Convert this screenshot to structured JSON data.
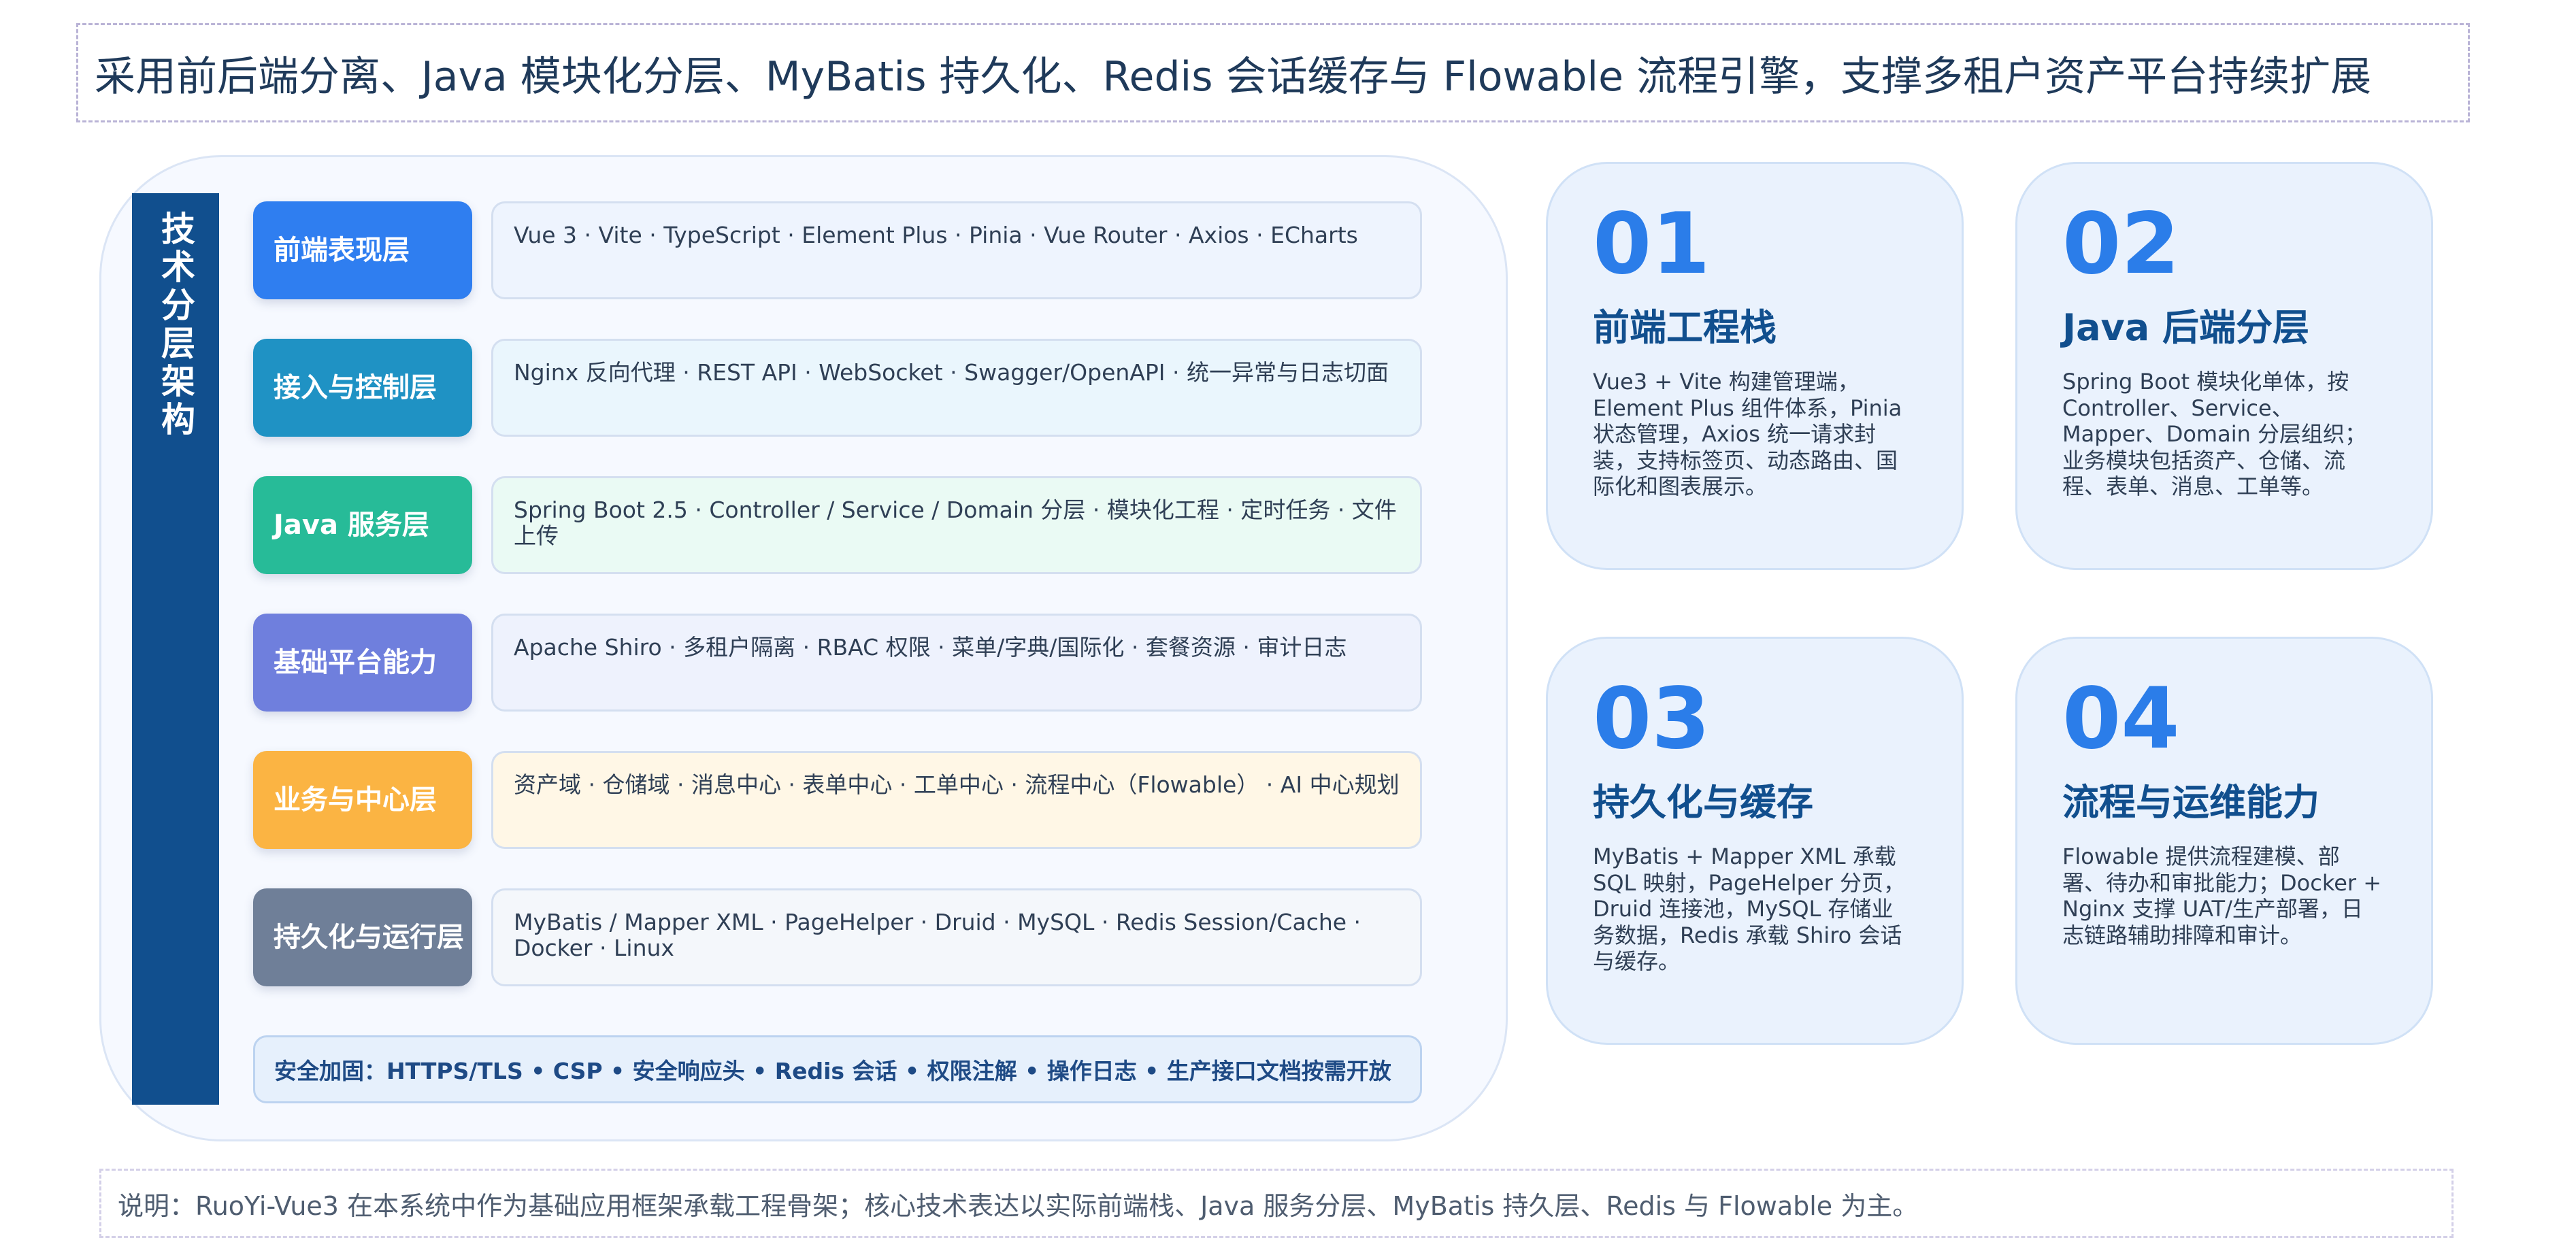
{
  "header": {
    "title": "采用前后端分离、Java 模块化分层、MyBatis 持久化、Redis 会话缓存与 Flowable 流程引擎，支撑多租户资产平台持续扩展"
  },
  "architecture": {
    "side_label": "技术分层架构",
    "layers": [
      {
        "label": "前端表现层",
        "color": "#2f7ef0",
        "desc_bg": "#eef4fe",
        "description": "Vue 3 · Vite · TypeScript · Element Plus · Pinia · Vue Router · Axios · ECharts"
      },
      {
        "label": "接入与控制层",
        "color": "#1f92c4",
        "desc_bg": "#eaf6fd",
        "description": "Nginx 反向代理 · REST API · WebSocket · Swagger/OpenAPI · 统一异常与日志切面"
      },
      {
        "label": "Java 服务层",
        "color": "#27bb98",
        "desc_bg": "#eafaf4",
        "description": "Spring Boot 2.5 · Controller / Service / Domain 分层 · 模块化工程 · 定时任务 · 文件上传"
      },
      {
        "label": "基础平台能力",
        "color": "#6f7fdd",
        "desc_bg": "#eef2fd",
        "description": "Apache Shiro · 多租户隔离 · RBAC 权限 · 菜单/字典/国际化 · 套餐资源 · 审计日志"
      },
      {
        "label": "业务与中心层",
        "color": "#fbb443",
        "desc_bg": "#fff7e6",
        "description": "资产域 · 仓储域 · 消息中心 · 表单中心 · 工单中心 · 流程中心（Flowable） · AI 中心规划"
      },
      {
        "label": "持久化与运行层",
        "color": "#6f7f98",
        "desc_bg": "#f4f7fb",
        "description": "MyBatis / Mapper XML · PageHelper · Druid · MySQL · Redis Session/Cache · Docker · Linux"
      }
    ],
    "security": "安全加固：HTTPS/TLS • CSP • 安全响应头 • Redis 会话 • 权限注解 • 操作日志 • 生产接口文档按需开放"
  },
  "cards": [
    {
      "num": "01",
      "title": "前端工程栈",
      "text": "Vue3 + Vite 构建管理端，Element Plus 组件体系，Pinia 状态管理，Axios 统一请求封装，支持标签页、动态路由、国际化和图表展示。"
    },
    {
      "num": "02",
      "title": "Java 后端分层",
      "text": "Spring Boot 模块化单体，按 Controller、Service、Mapper、Domain 分层组织；业务模块包括资产、仓储、流程、表单、消息、工单等。"
    },
    {
      "num": "03",
      "title": "持久化与缓存",
      "text": "MyBatis + Mapper XML 承载 SQL 映射，PageHelper 分页，Druid 连接池，MySQL 存储业务数据，Redis 承载 Shiro 会话与缓存。"
    },
    {
      "num": "04",
      "title": "流程与运维能力",
      "text": "Flowable 提供流程建模、部署、待办和审批能力；Docker + Nginx 支撑 UAT/生产部署，日志链路辅助排障和审计。"
    }
  ],
  "footer": {
    "note": "说明：RuoYi-Vue3 在本系统中作为基础应用框架承载工程骨架；核心技术表达以实际前端栈、Java 服务分层、MyBatis 持久层、Redis 与 Flowable 为主。"
  }
}
